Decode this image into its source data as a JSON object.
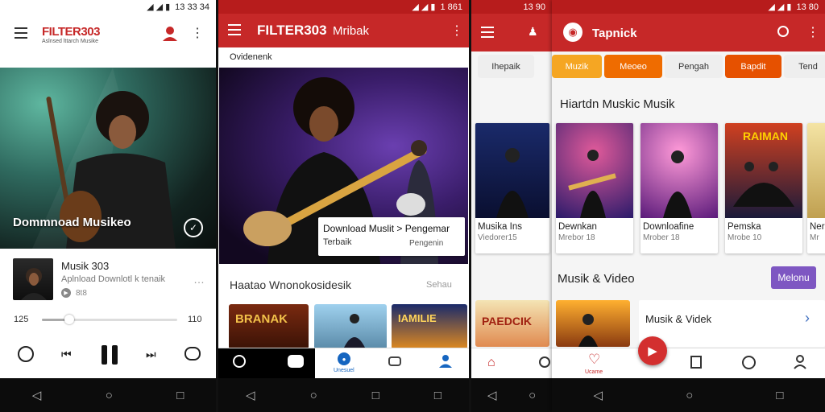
{
  "status": {
    "time1": "13 33 34",
    "time2": "1 861",
    "time3": "13 90",
    "time4": "13 80"
  },
  "screen1": {
    "app_title": "FILTER303",
    "app_subtitle": "Aslnsed lttarch Musike",
    "hero_caption": "Dommnoad Musikeo",
    "track_title": "Musik 303",
    "track_subtitle": "Aplnload Downlotl k tenaik",
    "track_meta": "8t8",
    "progress_start": "125",
    "progress_end": "110",
    "progress_fraction": 0.2
  },
  "screen2": {
    "app_title": "FILTER303",
    "app_subtitle": "Mribak",
    "section_label": "Ovidenenk",
    "overlay_title": "Download Muslit > Pengemar",
    "overlay_left": "Terbaik",
    "overlay_right": "Pengenin",
    "list_header": "Haatao Wnonokosidesik",
    "list_link": "Sehau",
    "thumb1_text": "BRANAK",
    "thumb3_text": "IAMILIE",
    "nav_label": "Unesuel"
  },
  "screen3": {
    "chip_label": "Ihepaik",
    "card_title": "Musika Ins",
    "card_meta": "Viedorer15",
    "thumb_text": "PAEDCIK"
  },
  "screen4": {
    "app_title": "Tapnick",
    "chips": [
      "Muzik",
      "Meoeo",
      "Pengah",
      "Bapdit",
      "Tend"
    ],
    "chip_colors": [
      "#f5a623",
      "#ef6c00",
      "#eeeeee",
      "#e65100",
      "#eeeeee"
    ],
    "section_title": "Hiartdn Muskic Musik",
    "cards": [
      {
        "title": "Dewnkan",
        "meta": "Mrebor 18"
      },
      {
        "title": "Downloafine",
        "meta": "Mrober 18"
      },
      {
        "title": "Pemska",
        "meta": "Mrobe 10"
      },
      {
        "title": "Ner",
        "meta": "Mr"
      }
    ],
    "card3_poster": "RAIMAN",
    "section2_title": "Musik & Video",
    "section2_button": "Melonu",
    "list_item": "Musik & Videk",
    "nav_label": "Ucame"
  },
  "colors": {
    "brand_red": "#c62828",
    "accent_purple": "#7e57c2",
    "play_red": "#d32f2f"
  }
}
